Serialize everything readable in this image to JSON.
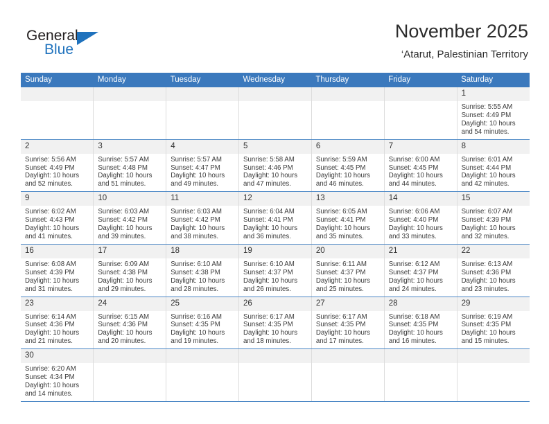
{
  "brand": {
    "name_top": "General",
    "name_bottom": "Blue",
    "accent_color": "#1f72bd",
    "triangle_icon": "triangle-icon"
  },
  "header": {
    "title": "November 2025",
    "subtitle": "‘Atarut, Palestinian Territory"
  },
  "calendar": {
    "header_bg": "#3b79bd",
    "row_separator_color": "#4a86c5",
    "daynum_bg": "#f1f1f1",
    "weekdays": [
      "Sunday",
      "Monday",
      "Tuesday",
      "Wednesday",
      "Thursday",
      "Friday",
      "Saturday"
    ],
    "weeks": [
      [
        {
          "day": "",
          "sunrise": "",
          "sunset": "",
          "daylight1": "",
          "daylight2": "",
          "empty": true
        },
        {
          "day": "",
          "sunrise": "",
          "sunset": "",
          "daylight1": "",
          "daylight2": "",
          "empty": true
        },
        {
          "day": "",
          "sunrise": "",
          "sunset": "",
          "daylight1": "",
          "daylight2": "",
          "empty": true
        },
        {
          "day": "",
          "sunrise": "",
          "sunset": "",
          "daylight1": "",
          "daylight2": "",
          "empty": true
        },
        {
          "day": "",
          "sunrise": "",
          "sunset": "",
          "daylight1": "",
          "daylight2": "",
          "empty": true
        },
        {
          "day": "",
          "sunrise": "",
          "sunset": "",
          "daylight1": "",
          "daylight2": "",
          "empty": true
        },
        {
          "day": "1",
          "sunrise": "Sunrise: 5:55 AM",
          "sunset": "Sunset: 4:49 PM",
          "daylight1": "Daylight: 10 hours",
          "daylight2": "and 54 minutes."
        }
      ],
      [
        {
          "day": "2",
          "sunrise": "Sunrise: 5:56 AM",
          "sunset": "Sunset: 4:49 PM",
          "daylight1": "Daylight: 10 hours",
          "daylight2": "and 52 minutes."
        },
        {
          "day": "3",
          "sunrise": "Sunrise: 5:57 AM",
          "sunset": "Sunset: 4:48 PM",
          "daylight1": "Daylight: 10 hours",
          "daylight2": "and 51 minutes."
        },
        {
          "day": "4",
          "sunrise": "Sunrise: 5:57 AM",
          "sunset": "Sunset: 4:47 PM",
          "daylight1": "Daylight: 10 hours",
          "daylight2": "and 49 minutes."
        },
        {
          "day": "5",
          "sunrise": "Sunrise: 5:58 AM",
          "sunset": "Sunset: 4:46 PM",
          "daylight1": "Daylight: 10 hours",
          "daylight2": "and 47 minutes."
        },
        {
          "day": "6",
          "sunrise": "Sunrise: 5:59 AM",
          "sunset": "Sunset: 4:45 PM",
          "daylight1": "Daylight: 10 hours",
          "daylight2": "and 46 minutes."
        },
        {
          "day": "7",
          "sunrise": "Sunrise: 6:00 AM",
          "sunset": "Sunset: 4:45 PM",
          "daylight1": "Daylight: 10 hours",
          "daylight2": "and 44 minutes."
        },
        {
          "day": "8",
          "sunrise": "Sunrise: 6:01 AM",
          "sunset": "Sunset: 4:44 PM",
          "daylight1": "Daylight: 10 hours",
          "daylight2": "and 42 minutes."
        }
      ],
      [
        {
          "day": "9",
          "sunrise": "Sunrise: 6:02 AM",
          "sunset": "Sunset: 4:43 PM",
          "daylight1": "Daylight: 10 hours",
          "daylight2": "and 41 minutes."
        },
        {
          "day": "10",
          "sunrise": "Sunrise: 6:03 AM",
          "sunset": "Sunset: 4:42 PM",
          "daylight1": "Daylight: 10 hours",
          "daylight2": "and 39 minutes."
        },
        {
          "day": "11",
          "sunrise": "Sunrise: 6:03 AM",
          "sunset": "Sunset: 4:42 PM",
          "daylight1": "Daylight: 10 hours",
          "daylight2": "and 38 minutes."
        },
        {
          "day": "12",
          "sunrise": "Sunrise: 6:04 AM",
          "sunset": "Sunset: 4:41 PM",
          "daylight1": "Daylight: 10 hours",
          "daylight2": "and 36 minutes."
        },
        {
          "day": "13",
          "sunrise": "Sunrise: 6:05 AM",
          "sunset": "Sunset: 4:41 PM",
          "daylight1": "Daylight: 10 hours",
          "daylight2": "and 35 minutes."
        },
        {
          "day": "14",
          "sunrise": "Sunrise: 6:06 AM",
          "sunset": "Sunset: 4:40 PM",
          "daylight1": "Daylight: 10 hours",
          "daylight2": "and 33 minutes."
        },
        {
          "day": "15",
          "sunrise": "Sunrise: 6:07 AM",
          "sunset": "Sunset: 4:39 PM",
          "daylight1": "Daylight: 10 hours",
          "daylight2": "and 32 minutes."
        }
      ],
      [
        {
          "day": "16",
          "sunrise": "Sunrise: 6:08 AM",
          "sunset": "Sunset: 4:39 PM",
          "daylight1": "Daylight: 10 hours",
          "daylight2": "and 31 minutes."
        },
        {
          "day": "17",
          "sunrise": "Sunrise: 6:09 AM",
          "sunset": "Sunset: 4:38 PM",
          "daylight1": "Daylight: 10 hours",
          "daylight2": "and 29 minutes."
        },
        {
          "day": "18",
          "sunrise": "Sunrise: 6:10 AM",
          "sunset": "Sunset: 4:38 PM",
          "daylight1": "Daylight: 10 hours",
          "daylight2": "and 28 minutes."
        },
        {
          "day": "19",
          "sunrise": "Sunrise: 6:10 AM",
          "sunset": "Sunset: 4:37 PM",
          "daylight1": "Daylight: 10 hours",
          "daylight2": "and 26 minutes."
        },
        {
          "day": "20",
          "sunrise": "Sunrise: 6:11 AM",
          "sunset": "Sunset: 4:37 PM",
          "daylight1": "Daylight: 10 hours",
          "daylight2": "and 25 minutes."
        },
        {
          "day": "21",
          "sunrise": "Sunrise: 6:12 AM",
          "sunset": "Sunset: 4:37 PM",
          "daylight1": "Daylight: 10 hours",
          "daylight2": "and 24 minutes."
        },
        {
          "day": "22",
          "sunrise": "Sunrise: 6:13 AM",
          "sunset": "Sunset: 4:36 PM",
          "daylight1": "Daylight: 10 hours",
          "daylight2": "and 23 minutes."
        }
      ],
      [
        {
          "day": "23",
          "sunrise": "Sunrise: 6:14 AM",
          "sunset": "Sunset: 4:36 PM",
          "daylight1": "Daylight: 10 hours",
          "daylight2": "and 21 minutes."
        },
        {
          "day": "24",
          "sunrise": "Sunrise: 6:15 AM",
          "sunset": "Sunset: 4:36 PM",
          "daylight1": "Daylight: 10 hours",
          "daylight2": "and 20 minutes."
        },
        {
          "day": "25",
          "sunrise": "Sunrise: 6:16 AM",
          "sunset": "Sunset: 4:35 PM",
          "daylight1": "Daylight: 10 hours",
          "daylight2": "and 19 minutes."
        },
        {
          "day": "26",
          "sunrise": "Sunrise: 6:17 AM",
          "sunset": "Sunset: 4:35 PM",
          "daylight1": "Daylight: 10 hours",
          "daylight2": "and 18 minutes."
        },
        {
          "day": "27",
          "sunrise": "Sunrise: 6:17 AM",
          "sunset": "Sunset: 4:35 PM",
          "daylight1": "Daylight: 10 hours",
          "daylight2": "and 17 minutes."
        },
        {
          "day": "28",
          "sunrise": "Sunrise: 6:18 AM",
          "sunset": "Sunset: 4:35 PM",
          "daylight1": "Daylight: 10 hours",
          "daylight2": "and 16 minutes."
        },
        {
          "day": "29",
          "sunrise": "Sunrise: 6:19 AM",
          "sunset": "Sunset: 4:35 PM",
          "daylight1": "Daylight: 10 hours",
          "daylight2": "and 15 minutes."
        }
      ],
      [
        {
          "day": "30",
          "sunrise": "Sunrise: 6:20 AM",
          "sunset": "Sunset: 4:34 PM",
          "daylight1": "Daylight: 10 hours",
          "daylight2": "and 14 minutes."
        },
        {
          "day": "",
          "sunrise": "",
          "sunset": "",
          "daylight1": "",
          "daylight2": "",
          "empty": true
        },
        {
          "day": "",
          "sunrise": "",
          "sunset": "",
          "daylight1": "",
          "daylight2": "",
          "empty": true
        },
        {
          "day": "",
          "sunrise": "",
          "sunset": "",
          "daylight1": "",
          "daylight2": "",
          "empty": true
        },
        {
          "day": "",
          "sunrise": "",
          "sunset": "",
          "daylight1": "",
          "daylight2": "",
          "empty": true
        },
        {
          "day": "",
          "sunrise": "",
          "sunset": "",
          "daylight1": "",
          "daylight2": "",
          "empty": true
        },
        {
          "day": "",
          "sunrise": "",
          "sunset": "",
          "daylight1": "",
          "daylight2": "",
          "empty": true
        }
      ]
    ]
  }
}
